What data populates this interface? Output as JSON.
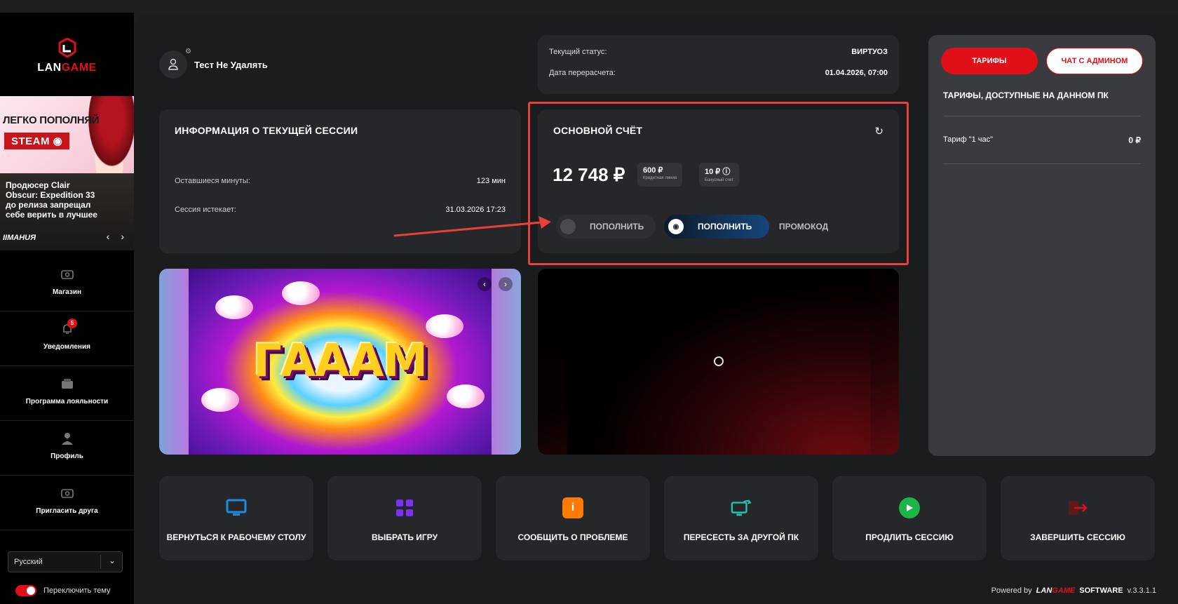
{
  "brand": {
    "name_lan": "LAN",
    "name_game": "GAME"
  },
  "promo": {
    "headline": "ЛЕГКО ПОПОЛНЯЙ",
    "badge": "STEAM",
    "news": "Продюсер Clair Obscur: Expedition 33 до релиза запрещал себе верить в лучшее",
    "source": "IIMAHUЯ"
  },
  "nav": [
    {
      "label": "Магазин"
    },
    {
      "label": "Уведомления",
      "badge": "5"
    },
    {
      "label": "Программа лояльности"
    },
    {
      "label": "Профиль"
    },
    {
      "label": "Пригласить друга"
    }
  ],
  "language": {
    "selected": "Русский"
  },
  "theme": {
    "label": "Переключить тему"
  },
  "user": {
    "name": "Тест Не Удалять"
  },
  "status": {
    "status_label": "Текущий статус:",
    "status_value": "ВИРТУОЗ",
    "recalc_label": "Дата перерасчета:",
    "recalc_value": "01.04.2026, 07:00"
  },
  "session": {
    "title": "ИНФОРМАЦИЯ О ТЕКУЩЕЙ СЕССИИ",
    "minutes_label": "Оставшиеся минуты:",
    "minutes_value": "123 мин",
    "expires_label": "Сессия истекает:",
    "expires_value": "31.03.2026 17:23"
  },
  "account": {
    "title": "ОСНОВНОЙ СЧЁТ",
    "balance": "12 748 ₽",
    "credit_amount": "600 ₽",
    "credit_label": "Кредитная линия",
    "bonus_amount": "10 ₽",
    "bonus_label": "Бонусный счет",
    "topup_label": "ПОПОЛНИТЬ",
    "steam_topup_label": "ПОПОЛНИТЬ",
    "promo_label": "ПРОМОКОД"
  },
  "banner": {
    "text": "ГАААМ"
  },
  "tariffs": {
    "tariffs_button": "ТАРИФЫ",
    "chat_button": "ЧАТ С АДМИНОМ",
    "title": "ТАРИФЫ, ДОСТУПНЫЕ НА ДАННОМ ПК",
    "items": [
      {
        "name": "Тариф \"1 час\"",
        "price": "0 ₽"
      }
    ]
  },
  "actions": [
    {
      "label": "ВЕРНУТЬСЯ К РАБОЧЕМУ СТОЛУ",
      "icon": "monitor-icon",
      "color": "#1e8be0"
    },
    {
      "label": "ВЫБРАТЬ ИГРУ",
      "icon": "grid-icon",
      "color": "#7b2ff0"
    },
    {
      "label": "СООБЩИТЬ О ПРОБЛЕМЕ",
      "icon": "info-icon",
      "color": "#ff7a00"
    },
    {
      "label": "ПЕРЕСЕСТЬ ЗА ДРУГОЙ ПК",
      "icon": "switch-pc-icon",
      "color": "#21c7b0"
    },
    {
      "label": "ПРОДЛИТЬ СЕССИЮ",
      "icon": "play-icon",
      "color": "#1db54a"
    },
    {
      "label": "ЗАВЕРШИТЬ СЕССИЮ",
      "icon": "exit-icon",
      "color": "#e10f17"
    }
  ],
  "footer": {
    "powered": "Powered by",
    "lan": "LAN",
    "game": "GAME",
    "software": "SOFTWARE",
    "version": "v.3.3.1.1"
  },
  "colors": {
    "accent": "#e10f17",
    "card": "#26272a",
    "panel": "#3a3b3e"
  }
}
